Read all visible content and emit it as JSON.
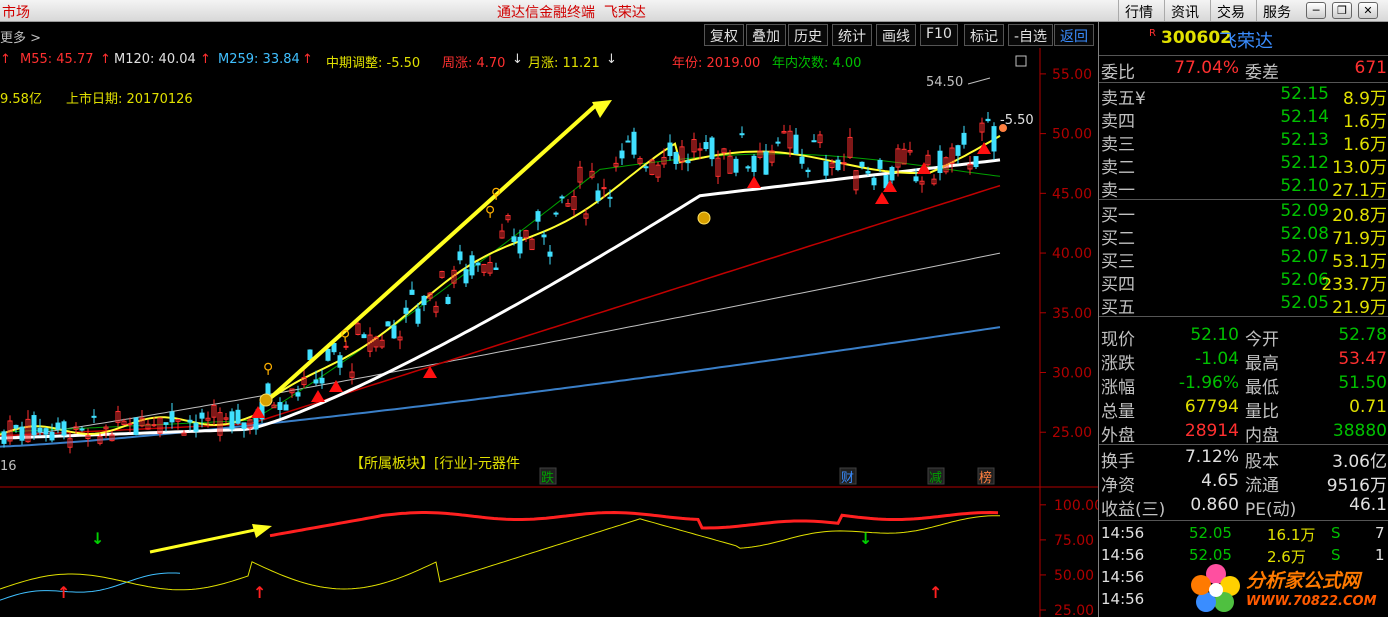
{
  "titlebar": {
    "market_label": "市场",
    "app_title": "通达信金融终端  飞荣达",
    "buttons": [
      "行情",
      "资讯",
      "交易",
      "服务"
    ],
    "window_controls": [
      "minimize",
      "restore",
      "close"
    ]
  },
  "toolbar": {
    "more_label": "更多 >",
    "buttons": [
      "复权",
      "叠加",
      "历史",
      "统计",
      "画线",
      "F10",
      "标记",
      "-自选",
      "返回"
    ]
  },
  "indicators": {
    "ma55": "M55: 45.77",
    "ma120": "M120: 40.04",
    "ma259": "M259: 33.84",
    "mid_adjust": "中期调整: -5.50",
    "week_change": "周涨: 4.70",
    "month_change": "月涨: 11.21",
    "year": "年份: 2019.00",
    "year_count": "年内次数: 4.00"
  },
  "info2": {
    "market_cap": "9.58亿",
    "listing_date": "上市日期: 20170126"
  },
  "chart_annotations": {
    "high_label": "54.50",
    "adjust_label": "-5.50",
    "left_date": "16",
    "sector": "【所属板块】[行业]-元器件",
    "markers": [
      "跌",
      "财",
      "减",
      "榜"
    ]
  },
  "chart_data": {
    "type": "line",
    "price_axis": {
      "ticks": [
        55.0,
        50.0,
        45.0,
        40.0,
        35.0,
        30.0,
        25.0
      ],
      "range": [
        21.0,
        57.0
      ]
    },
    "sub_axis": {
      "ticks": [
        100.0,
        75.0,
        50.0,
        25.0
      ],
      "range": [
        20,
        112
      ]
    },
    "series": [
      {
        "name": "M55",
        "color": "#c0c0c0"
      },
      {
        "name": "M120",
        "color": "#c0c0c0"
      },
      {
        "name": "M259",
        "color": "#3a8dff"
      }
    ]
  },
  "stock": {
    "flag": "R",
    "code": "300602",
    "name": "飞荣达"
  },
  "order_ratio": {
    "label": "委比",
    "value": "77.04%",
    "label2": "委差",
    "value2": "671"
  },
  "asks": [
    {
      "label": "卖五¥",
      "price": "52.15",
      "vol": "8.9万"
    },
    {
      "label": "卖四",
      "price": "52.14",
      "vol": "1.6万"
    },
    {
      "label": "卖三",
      "price": "52.13",
      "vol": "1.6万"
    },
    {
      "label": "卖二",
      "price": "52.12",
      "vol": "13.0万"
    },
    {
      "label": "卖一",
      "price": "52.10",
      "vol": "27.1万"
    }
  ],
  "bids": [
    {
      "label": "买一",
      "price": "52.09",
      "vol": "20.8万"
    },
    {
      "label": "买二",
      "price": "52.08",
      "vol": "71.9万"
    },
    {
      "label": "买三",
      "price": "52.07",
      "vol": "53.1万"
    },
    {
      "label": "买四",
      "price": "52.06",
      "vol": "233.7万"
    },
    {
      "label": "买五",
      "price": "52.05",
      "vol": "21.9万"
    }
  ],
  "quote": [
    {
      "l1": "现价",
      "v1": "52.10",
      "c1": "green",
      "l2": "今开",
      "v2": "52.78",
      "c2": "green"
    },
    {
      "l1": "涨跌",
      "v1": "-1.04",
      "c1": "green",
      "l2": "最高",
      "v2": "53.47",
      "c2": "red"
    },
    {
      "l1": "涨幅",
      "v1": "-1.96%",
      "c1": "green",
      "l2": "最低",
      "v2": "51.50",
      "c2": "green"
    },
    {
      "l1": "总量",
      "v1": "67794",
      "c1": "yellow",
      "l2": "量比",
      "v2": "0.71",
      "c2": "yellow"
    },
    {
      "l1": "外盘",
      "v1": "28914",
      "c1": "red",
      "l2": "内盘",
      "v2": "38880",
      "c2": "green"
    }
  ],
  "stats": [
    {
      "l1": "换手",
      "v1": "7.12%",
      "l2": "股本",
      "v2": "3.06亿"
    },
    {
      "l1": "净资",
      "v1": "4.65",
      "l2": "流通",
      "v2": "9516万"
    },
    {
      "l1": "收益(三)",
      "v1": "0.860",
      "l2": "PE(动)",
      "v2": "46.1"
    }
  ],
  "ticks": [
    {
      "time": "14:56",
      "price": "52.05",
      "vol": "16.1万",
      "side": "S",
      "n": "7"
    },
    {
      "time": "14:56",
      "price": "52.05",
      "vol": "2.6万",
      "side": "S",
      "n": "1"
    },
    {
      "time": "14:56",
      "price": "",
      "vol": "",
      "side": "",
      "n": ""
    },
    {
      "time": "14:56",
      "price": "",
      "vol": "",
      "side": "",
      "n": ""
    }
  ],
  "logo": {
    "line1": "分析家公式网",
    "line2": "WWW.70822.COM"
  }
}
